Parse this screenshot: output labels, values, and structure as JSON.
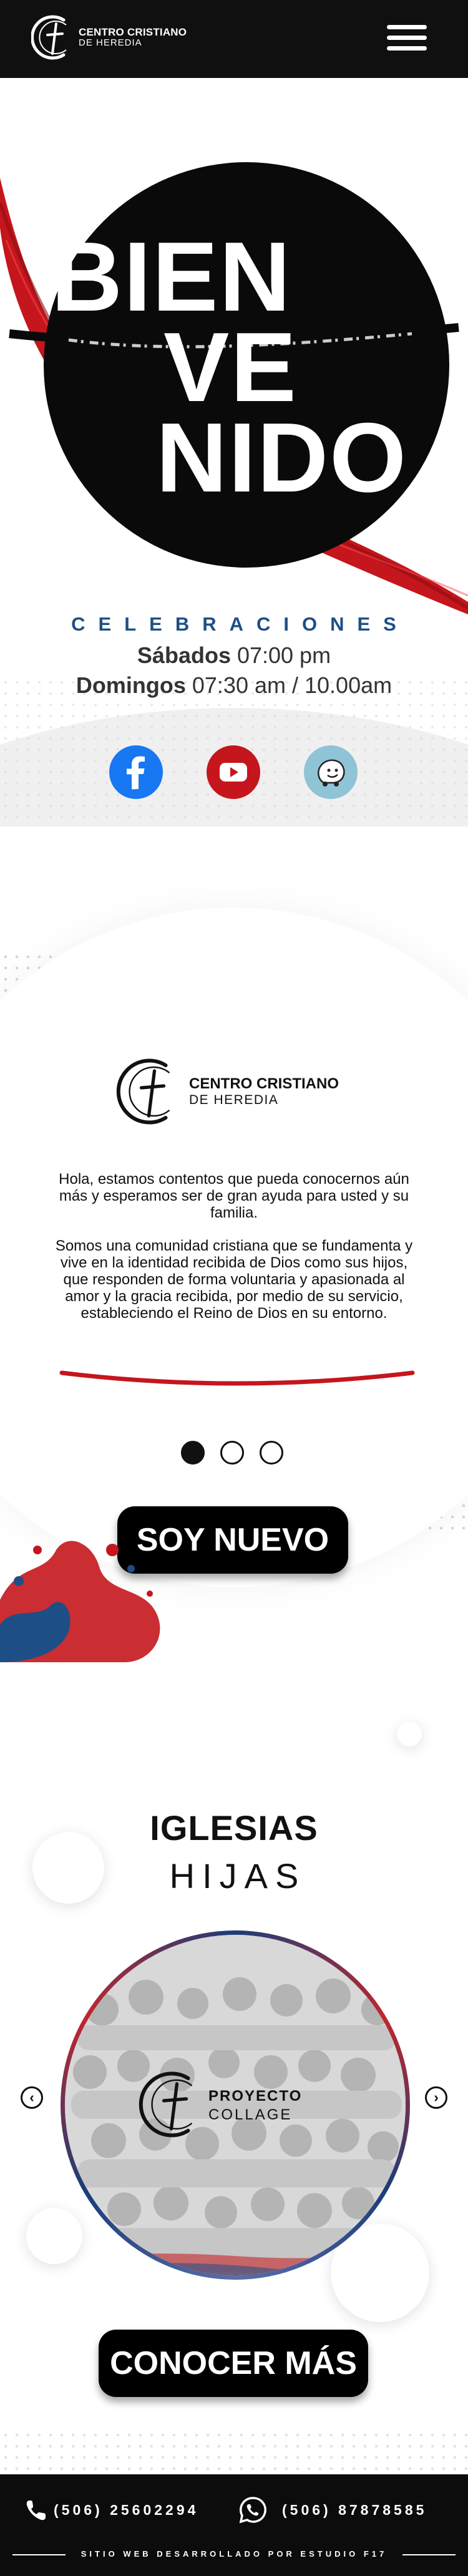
{
  "header": {
    "logo_line1": "CENTRO CRISTIANO",
    "logo_line2": "DE HEREDIA",
    "menu_icon": "hamburger-menu-icon"
  },
  "hero": {
    "title_line1": "BIEN",
    "title_line2": "VE",
    "title_line3": "NIDO",
    "celebrations_label": "CELEBRACIONES",
    "schedule": [
      {
        "day": "Sábados",
        "time": "07:00 pm"
      },
      {
        "day": "Domingos",
        "time": "07:30 am / 10.00am"
      }
    ],
    "social": [
      {
        "name": "facebook",
        "icon": "facebook-icon",
        "color": "#1877f2"
      },
      {
        "name": "youtube",
        "icon": "youtube-icon",
        "color": "#c4161c"
      },
      {
        "name": "waze",
        "icon": "waze-icon",
        "color": "#8fc3d6"
      }
    ]
  },
  "welcome": {
    "logo_line1": "CENTRO CRISTIANO",
    "logo_line2": "DE HEREDIA",
    "paragraph1": "Hola, estamos contentos que pueda conocernos aún más y esperamos ser de gran ayuda para usted y su familia.",
    "paragraph2": "Somos una comunidad cristiana que se fundamenta y vive en la identidad recibida de Dios como sus hijos, que responden de forma voluntaria y apasionada al amor y la gracia recibida, por medio de su servicio, estableciendo el Reino de Dios en su entorno.",
    "slides_total": 3,
    "slide_active": 1,
    "button_label": "SOY NUEVO"
  },
  "iglesias": {
    "title_line1": "IGLESIAS",
    "title_line2": "HIJAS",
    "slide_logo_line1": "PROYECTO",
    "slide_logo_line2": "COLLAGE",
    "prev_icon": "chevron-left-icon",
    "next_icon": "chevron-right-icon",
    "button_label": "CONOCER MÁS"
  },
  "footer": {
    "phone1": "(506) 25602294",
    "phone2": "(506) 87878585",
    "credit": "SITIO WEB DESARROLLADO POR ESTUDIO F17"
  },
  "colors": {
    "accent_blue": "#1d4f86",
    "accent_red": "#c4161c",
    "dark": "#101010"
  }
}
